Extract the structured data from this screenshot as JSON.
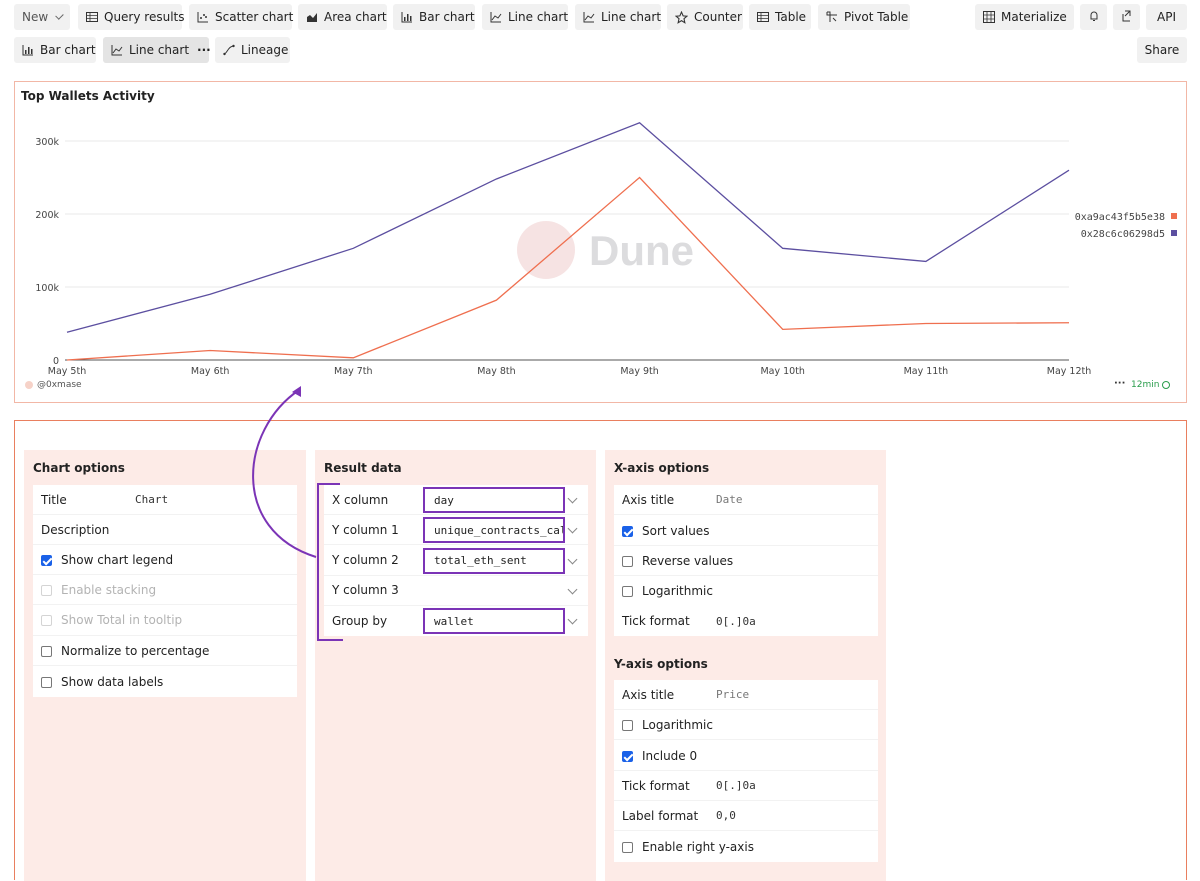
{
  "toolbar": {
    "new_label": "New",
    "tabs_row1": [
      {
        "label": "Query results",
        "icon": "table-icon"
      },
      {
        "label": "Scatter chart",
        "icon": "scatter-icon"
      },
      {
        "label": "Area chart",
        "icon": "area-icon"
      },
      {
        "label": "Bar chart",
        "icon": "bar-icon"
      },
      {
        "label": "Line chart",
        "icon": "line-icon"
      },
      {
        "label": "Line chart",
        "icon": "line-icon"
      },
      {
        "label": "Counter",
        "icon": "star-icon"
      },
      {
        "label": "Table",
        "icon": "table-icon"
      },
      {
        "label": "Pivot Table",
        "icon": "pivot-icon"
      }
    ],
    "materialize_label": "Materialize",
    "api_label": "API",
    "tabs_row2": [
      {
        "label": "Bar chart",
        "icon": "bar-icon"
      },
      {
        "label": "Line chart",
        "icon": "line-icon",
        "active": true
      },
      {
        "label": "Lineage",
        "icon": "lineage-icon"
      }
    ],
    "share_label": "Share"
  },
  "chart": {
    "title": "Top Wallets Activity",
    "watermark": "Dune",
    "author": "@0xmase",
    "freshness": "12min",
    "more": "···"
  },
  "chart_data": {
    "type": "line",
    "categories": [
      "May 5th",
      "May 6th",
      "May 7th",
      "May 8th",
      "May 9th",
      "May 10th",
      "May 11th",
      "May 12th"
    ],
    "yticks": [
      "0",
      "100k",
      "200k",
      "300k"
    ],
    "ylim": [
      0,
      300000
    ],
    "legend_position": "right",
    "grid": true,
    "series": [
      {
        "name": "0xa9ac43f5b5e38",
        "color": "#ef6f4f",
        "values": [
          0,
          13000,
          3000,
          82000,
          250000,
          42000,
          50000,
          51000
        ]
      },
      {
        "name": "0x28c6c06298d5",
        "color": "#5c4fa0",
        "values": [
          38000,
          90000,
          153000,
          248000,
          325000,
          153000,
          135000,
          260000
        ]
      }
    ]
  },
  "chart_options": {
    "title": "Chart options",
    "title_label": "Title",
    "title_value": "Chart",
    "description_label": "Description",
    "checks": [
      {
        "label": "Show chart legend",
        "checked": true,
        "disabled": false
      },
      {
        "label": "Enable stacking",
        "checked": false,
        "disabled": true
      },
      {
        "label": "Show Total in tooltip",
        "checked": false,
        "disabled": true
      },
      {
        "label": "Normalize to percentage",
        "checked": false,
        "disabled": false
      },
      {
        "label": "Show data labels",
        "checked": false,
        "disabled": false
      }
    ]
  },
  "result_data": {
    "title": "Result data",
    "rows": [
      {
        "label": "X column",
        "value": "day"
      },
      {
        "label": "Y column 1",
        "value": "unique_contracts_cal"
      },
      {
        "label": "Y column 2",
        "value": "total_eth_sent"
      },
      {
        "label": "Y column 3",
        "value": ""
      },
      {
        "label": "Group by",
        "value": "wallet"
      }
    ]
  },
  "x_axis": {
    "title": "X-axis options",
    "axis_title_label": "Axis title",
    "axis_title_value": "Date",
    "checks": [
      {
        "label": "Sort values",
        "checked": true
      },
      {
        "label": "Reverse values",
        "checked": false
      },
      {
        "label": "Logarithmic",
        "checked": false
      }
    ],
    "tick_format_label": "Tick format",
    "tick_format_value": "0[.]0a"
  },
  "y_axis": {
    "title": "Y-axis options",
    "axis_title_label": "Axis title",
    "axis_title_value": "Price",
    "log_label": "Logarithmic",
    "log_checked": false,
    "include0_label": "Include 0",
    "include0_checked": true,
    "tick_format_label": "Tick format",
    "tick_format_value": "0[.]0a",
    "label_format_label": "Label format",
    "label_format_value": "0,0",
    "right_axis_label": "Enable right y-axis",
    "right_axis_checked": false
  },
  "colors": {
    "accent": "#7b34b6",
    "border": "#e97f5f",
    "panel": "#fdebe7"
  }
}
